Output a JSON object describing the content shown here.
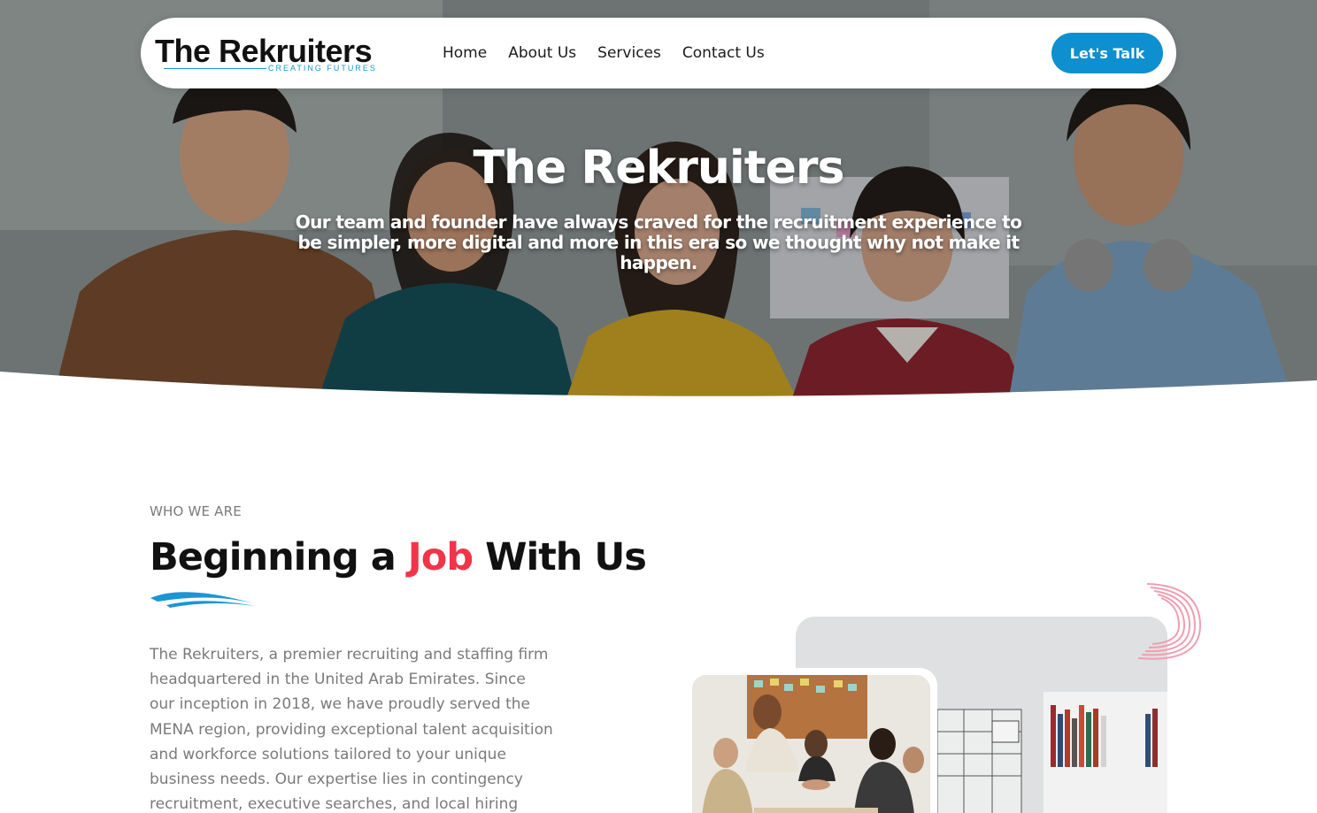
{
  "navbar": {
    "logo": {
      "main": "The Rekruiters",
      "tagline": "CREATING FUTURES"
    },
    "links": [
      {
        "label": "Home"
      },
      {
        "label": "About Us"
      },
      {
        "label": "Services"
      },
      {
        "label": "Contact Us"
      }
    ],
    "cta_label": "Let's Talk"
  },
  "hero": {
    "title": "The Rekruiters",
    "subtitle": "Our team and founder have always craved for the recruitment experience to be simpler, more digital and more in this era so we thought why not make it happen."
  },
  "about": {
    "eyebrow": "WHO WE ARE",
    "heading_before": "Beginning a ",
    "heading_highlight": "Job",
    "heading_after": " With Us",
    "body": "The Rekruiters, a premier recruiting and staffing firm headquartered in the United Arab Emirates. Since our inception in 2018, we have proudly served the MENA region, providing exceptional talent acquisition and workforce solutions tailored to your unique business needs. Our expertise lies in contingency recruitment, executive searches, and local hiring initiatives such as"
  },
  "colors": {
    "brand_blue": "#0d8fd0",
    "highlight_red": "#f0354a",
    "text_dark": "#111111",
    "text_muted": "#7a7a7a"
  },
  "icons": {
    "swoosh": "blue-brush-swoosh",
    "decor": "pink-scribble-ring"
  }
}
